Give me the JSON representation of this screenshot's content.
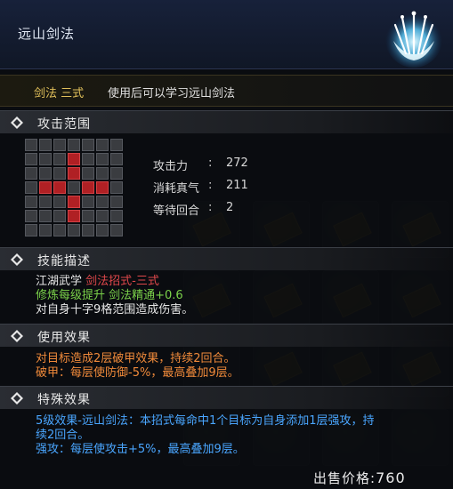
{
  "header": {
    "title": "远山剑法",
    "emblem_icon": "ice-sword-emblem-icon"
  },
  "item": {
    "type": "剑法 三式",
    "description": "使用后可以学习远山剑法"
  },
  "sections": {
    "range": "攻击范围",
    "skill_desc": "技能描述",
    "use_effect": "使用效果",
    "special_effect": "特殊效果"
  },
  "attack_range": {
    "rows": 7,
    "cols": 7,
    "hit_cells": [
      [
        1,
        3
      ],
      [
        2,
        3
      ],
      [
        3,
        1
      ],
      [
        3,
        2
      ],
      [
        3,
        4
      ],
      [
        3,
        5
      ],
      [
        4,
        3
      ],
      [
        5,
        3
      ]
    ]
  },
  "stats": [
    {
      "label": "攻击力",
      "colon": ":",
      "value": "272"
    },
    {
      "label": "消耗真气",
      "colon": ":",
      "value": "211"
    },
    {
      "label": "等待回合",
      "colon": ":",
      "value": "2"
    }
  ],
  "skill_description": {
    "line1_prefix": "江湖武学 ",
    "line1_highlight": "剑法招式-三式",
    "line2": "修炼每级提升 剑法精通+0.6",
    "line3": "对自身十字9格范围造成伤害。"
  },
  "use_effect": {
    "line1": "对目标造成2层破甲效果，持续2回合。",
    "line2": "破甲：每层使防御-5%，最高叠加9层。"
  },
  "special_effect": {
    "line1": "5级效果-远山剑法：本招式每命中1个目标为自身添加1层强攻，持",
    "line2": "续2回合。",
    "line3": "强攻：每层使攻击+5%，最高叠加9层。"
  },
  "price": {
    "label": "出售价格",
    "colon": ":",
    "value": "760"
  },
  "colors": {
    "title_gold": "#e2c15b",
    "hit_red": "#b02024",
    "text_red": "#e0484b",
    "text_green": "#7bd24a",
    "text_orange": "#f08a3a",
    "text_blue": "#4aa6ff"
  }
}
